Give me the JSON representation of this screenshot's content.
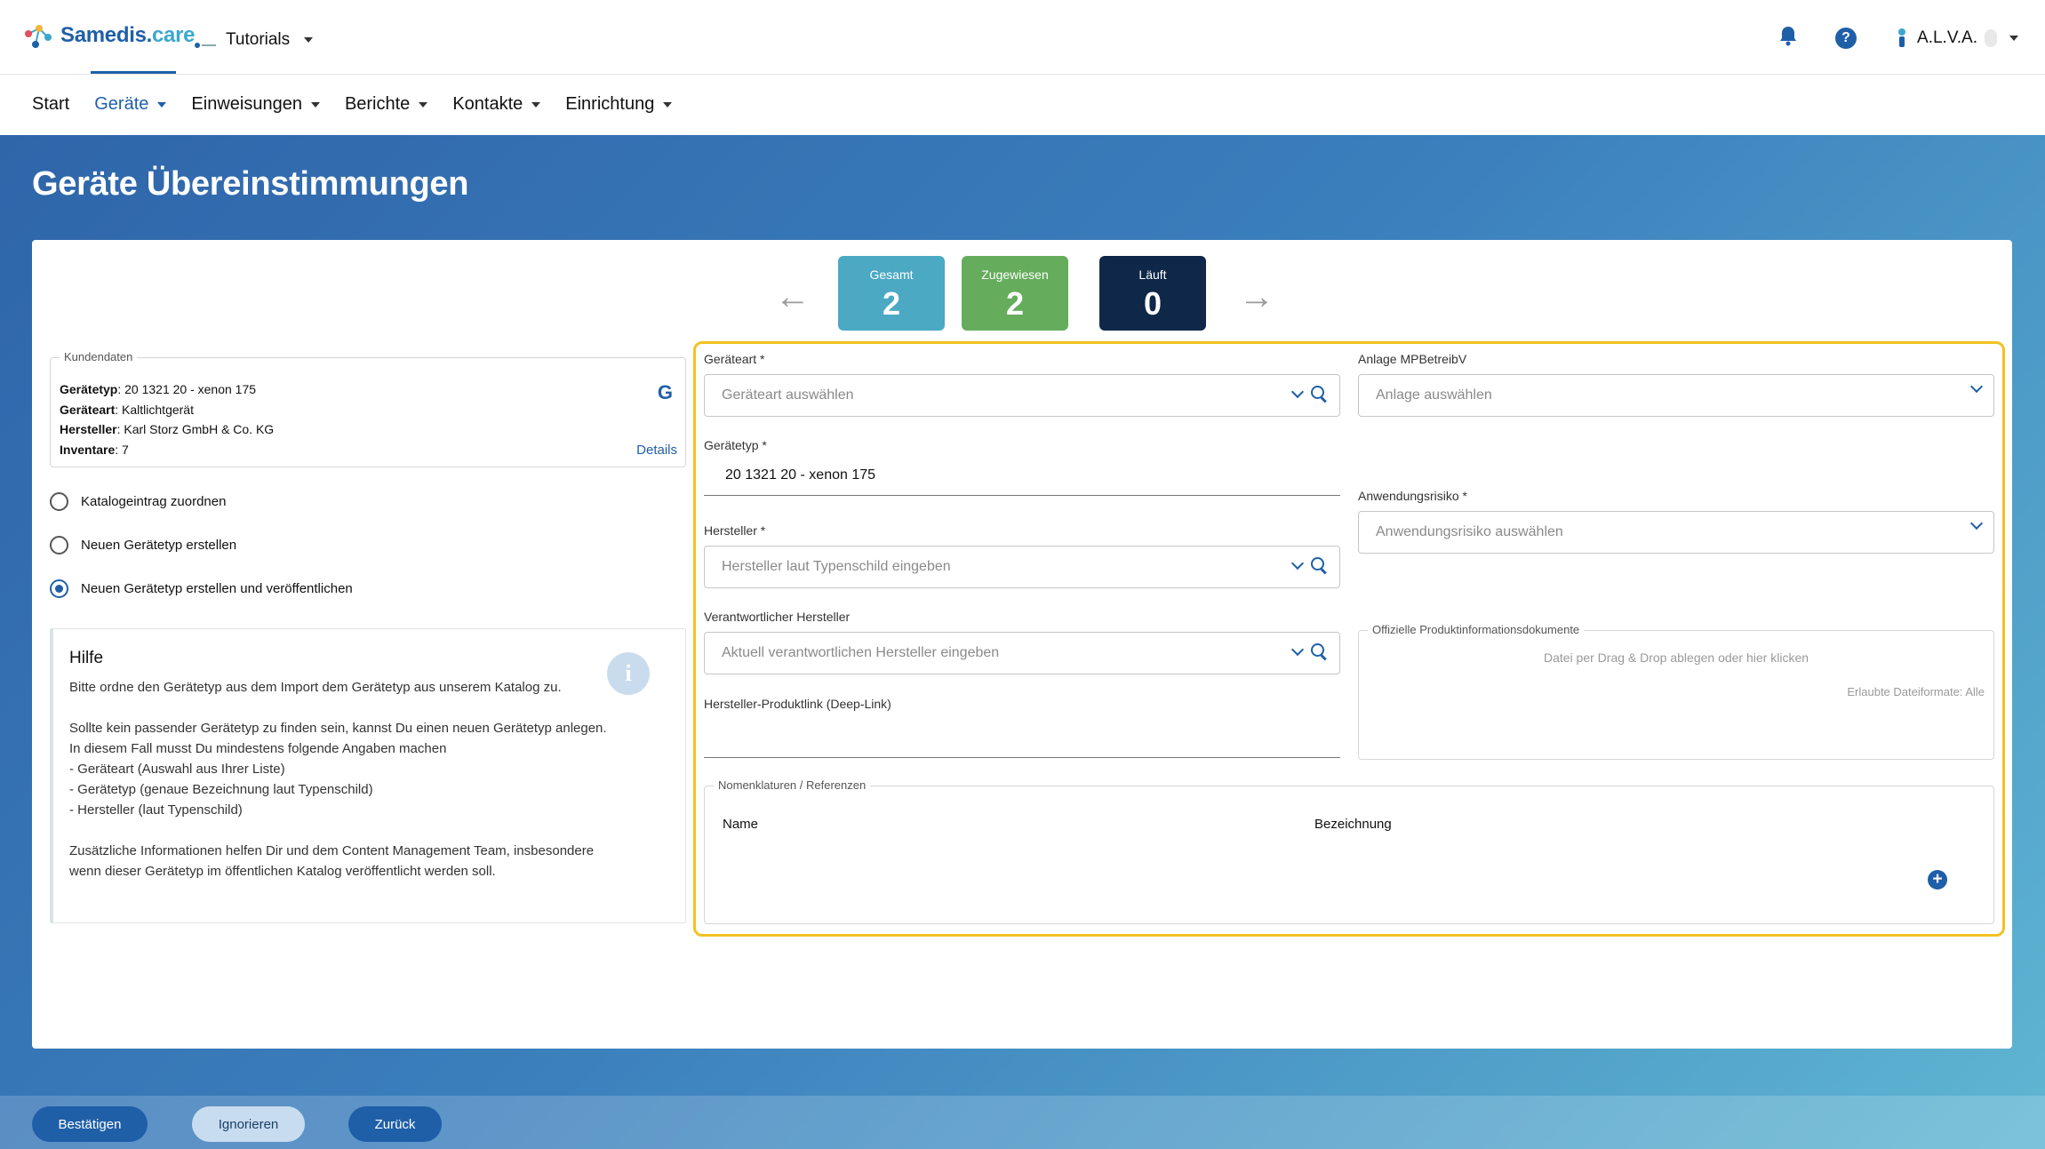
{
  "header": {
    "logo_main": "Samedis.",
    "logo_accent": "care",
    "tenant": "Tutorials",
    "user": "A.L.V.A."
  },
  "nav": {
    "items": [
      {
        "label": "Start"
      },
      {
        "label": "Geräte"
      },
      {
        "label": "Einweisungen"
      },
      {
        "label": "Berichte"
      },
      {
        "label": "Kontakte"
      },
      {
        "label": "Einrichtung"
      }
    ]
  },
  "page": {
    "title": "Geräte Übereinstimmungen"
  },
  "stats": {
    "total": {
      "label": "Gesamt",
      "value": "2",
      "color": "#4ba9c4"
    },
    "assigned": {
      "label": "Zugewiesen",
      "value": "2",
      "color": "#65ad5c"
    },
    "running": {
      "label": "Läuft",
      "value": "0",
      "color": "#0f2748"
    }
  },
  "customer": {
    "legend": "Kundendaten",
    "device_type_label": "Gerätetyp",
    "device_type_value": ": 20 1321 20 - xenon 175",
    "device_kind_label": "Geräteart",
    "device_kind_value": ": Kaltlichtgerät",
    "manufacturer_label": "Hersteller",
    "manufacturer_value": ": Karl Storz GmbH & Co. KG",
    "inventory_label": "Inventare",
    "inventory_value": ": 7",
    "details_link": "Details"
  },
  "options": {
    "assign": "Katalogeintrag zuordnen",
    "create": "Neuen Gerätetyp erstellen",
    "create_publish": "Neuen Gerätetyp erstellen und veröffentlichen",
    "selected": "create_publish"
  },
  "help": {
    "title": "Hilfe",
    "text": "Bitte ordne den Gerätetyp aus dem Import dem Gerätetyp aus unserem Katalog zu.\n\nSollte kein passender Gerätetyp zu finden sein, kannst Du einen neuen Gerätetyp anlegen. In diesem Fall musst Du mindestens folgende Angaben machen\n- Geräteart (Auswahl aus Ihrer Liste)\n- Gerätetyp (genaue Bezeichnung laut Typenschild)\n- Hersteller (laut Typenschild)\n\nZusätzliche Informationen helfen Dir und dem Content Management Team, insbesondere wenn dieser Gerätetyp im öffentlichen Katalog veröffentlicht werden soll."
  },
  "form": {
    "device_kind_label": "Geräteart *",
    "device_kind_placeholder": "Geräteart auswählen",
    "device_type_label": "Gerätetyp *",
    "device_type_value": "20 1321 20 - xenon 175",
    "manufacturer_label": "Hersteller *",
    "manufacturer_placeholder": "Hersteller laut Typenschild eingeben",
    "resp_manufacturer_label": "Verantwortlicher Hersteller",
    "resp_manufacturer_placeholder": "Aktuell verantwortlichen Hersteller eingeben",
    "deeplink_label": "Hersteller-Produktlink (Deep-Link)",
    "deeplink_value": "",
    "annex_label": "Anlage MPBetreibV",
    "annex_placeholder": "Anlage auswählen",
    "risk_label": "Anwendungsrisiko *",
    "risk_placeholder": "Anwendungsrisiko auswählen",
    "docs_legend": "Offizielle Produktinformationsdokumente",
    "docs_drop": "Datei per Drag & Drop ablegen oder hier klicken",
    "docs_formats": "Erlaubte Dateiformate: Alle",
    "nomen_legend": "Nomenklaturen / Referenzen",
    "nomen_col_name": "Name",
    "nomen_col_desc": "Bezeichnung"
  },
  "footer": {
    "confirm": "Bestätigen",
    "ignore": "Ignorieren",
    "back": "Zurück"
  }
}
